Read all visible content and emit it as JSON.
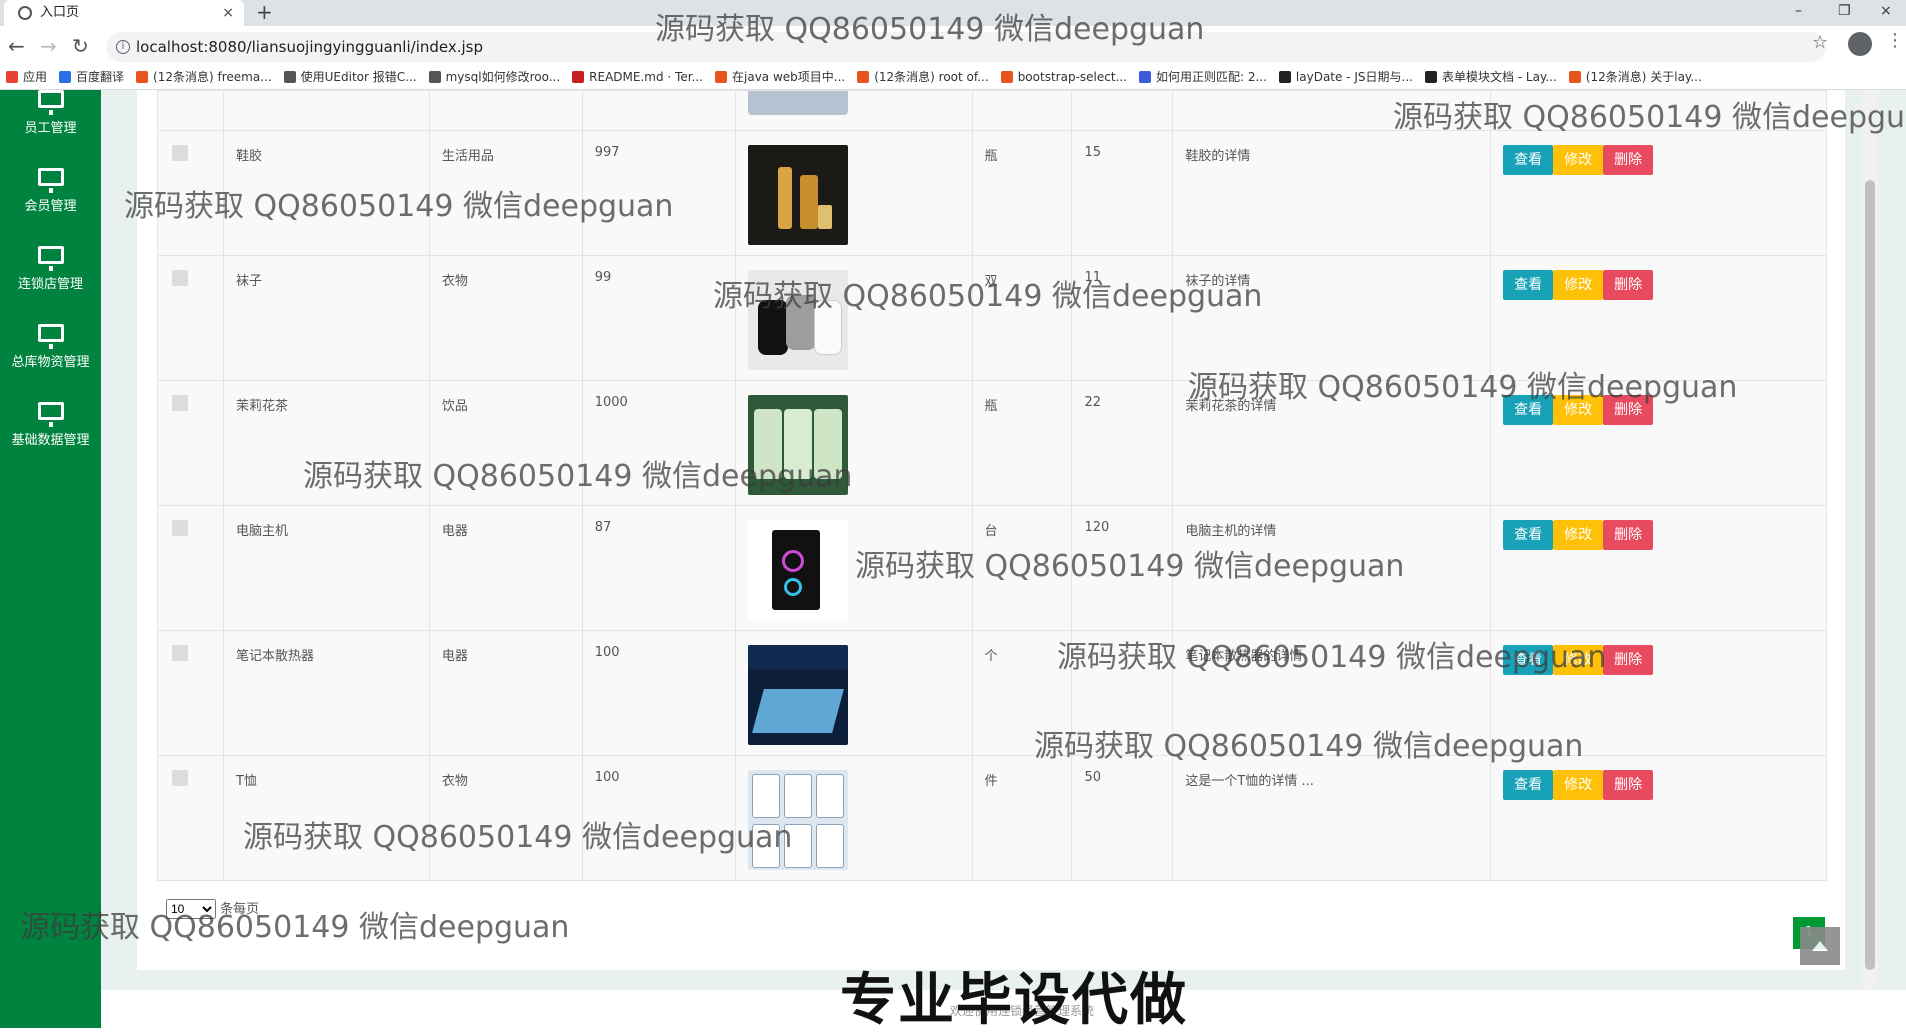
{
  "browser": {
    "tab_title": "入口页",
    "tab_close": "×",
    "new_tab": "+",
    "url": "localhost:8080/liansuojingyingguanli/index.jsp",
    "win_min": "–",
    "win_restore": "❐",
    "win_close": "×"
  },
  "bookmarks": [
    {
      "label": "应用",
      "color": "#e94235"
    },
    {
      "label": "百度翻译",
      "color": "#2b6de5"
    },
    {
      "label": "(12条消息) freema...",
      "color": "#e8541e"
    },
    {
      "label": "使用UEditor 报错C...",
      "color": "#555555"
    },
    {
      "label": "mysql如何修改roo...",
      "color": "#555555"
    },
    {
      "label": "README.md · Ter...",
      "color": "#c71d23"
    },
    {
      "label": "在java web项目中...",
      "color": "#e8541e"
    },
    {
      "label": "(12条消息) root of...",
      "color": "#e8541e"
    },
    {
      "label": "bootstrap-select...",
      "color": "#e8541e"
    },
    {
      "label": "如何用正则匹配: 2...",
      "color": "#3b5bdb"
    },
    {
      "label": "layDate - JS日期与...",
      "color": "#222222"
    },
    {
      "label": "表单模块文档 - Lay...",
      "color": "#222222"
    },
    {
      "label": "(12条消息) 关于lay...",
      "color": "#e8541e"
    }
  ],
  "sidebar": {
    "items": [
      {
        "label": "员工管理"
      },
      {
        "label": "会员管理"
      },
      {
        "label": "连锁店管理"
      },
      {
        "label": "总库物资管理"
      },
      {
        "label": "基础数据管理"
      }
    ]
  },
  "table": {
    "rows": [
      {
        "name": "鞋胶",
        "category": "生活用品",
        "price": "997",
        "unit": "瓶",
        "stock": "15",
        "detail": "鞋胶的详情",
        "thumb": "glue"
      },
      {
        "name": "袜子",
        "category": "衣物",
        "price": "99",
        "unit": "双",
        "stock": "11",
        "detail": "袜子的详情",
        "thumb": "socks"
      },
      {
        "name": "茉莉花茶",
        "category": "饮品",
        "price": "1000",
        "unit": "瓶",
        "stock": "22",
        "detail": "茉莉花茶的详情",
        "thumb": "tea"
      },
      {
        "name": "电脑主机",
        "category": "电器",
        "price": "87",
        "unit": "台",
        "stock": "120",
        "detail": "电脑主机的详情",
        "thumb": "pc"
      },
      {
        "name": "笔记本散热器",
        "category": "电器",
        "price": "100",
        "unit": "个",
        "stock": "",
        "detail": "笔记本散热器的详情",
        "thumb": "cooler"
      },
      {
        "name": "T恤",
        "category": "衣物",
        "price": "100",
        "unit": "件",
        "stock": "50",
        "detail": "这是一个T恤的详情 ...",
        "thumb": "tshirt"
      }
    ],
    "btn_view": "查看",
    "btn_edit": "修改",
    "btn_delete": "删除"
  },
  "pager": {
    "page_size": "10",
    "per_page_label": "条每页",
    "current_page": "1"
  },
  "footer": "欢迎使用连锁经营管理系统",
  "banner": "专业毕设代做",
  "watermark": "源码获取 QQ86050149 微信deepguan"
}
